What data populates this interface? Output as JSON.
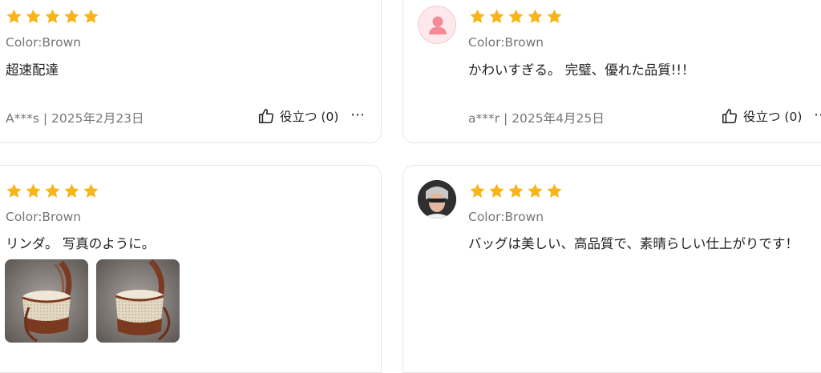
{
  "reviews": [
    {
      "rating": 5,
      "color": "Color:Brown",
      "text": "超速配達",
      "meta": "A***s | 2025年2月23日",
      "helpful": "役立つ (0)",
      "more": "⋯"
    },
    {
      "rating": 5,
      "avatar": "default-avatar",
      "color": "Color:Brown",
      "text": "かわいすぎる。 完璧、優れた品質!!！",
      "meta": "a***r | 2025年4月25日",
      "helpful": "役立つ (0)",
      "more": "⋯"
    },
    {
      "rating": 5,
      "color": "Color:Brown",
      "text": "リンダ。 写真のように。",
      "photos": [
        "bucket-bag-photo",
        "bucket-bag-photo"
      ]
    },
    {
      "rating": 5,
      "avatar": "photo-avatar",
      "color": "Color:Brown",
      "text": "バッグは美しい、高品質で、素晴らしい仕上がりです！"
    }
  ],
  "colors": {
    "star": "#f8b51a",
    "muted_text": "#777777",
    "card_border": "#e6e6e6",
    "avatar_bg": "#fde8ec",
    "avatar_icon": "#f28b96"
  }
}
